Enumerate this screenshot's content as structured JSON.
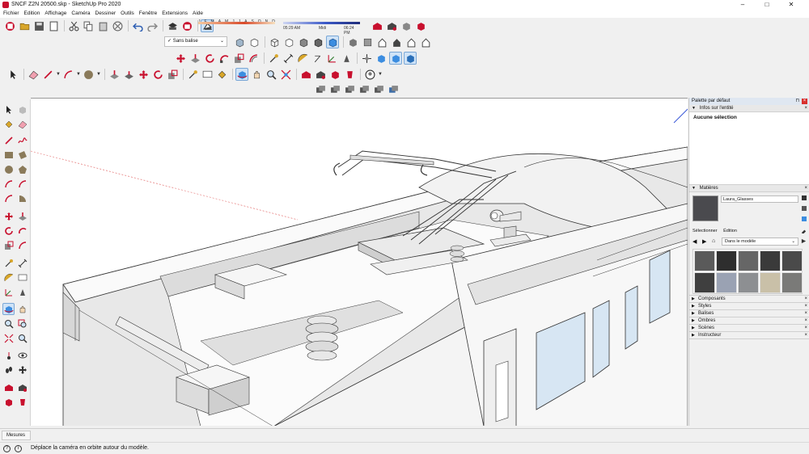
{
  "window": {
    "title": "SNCF Z2N 20500.skp - SketchUp Pro 2020",
    "controls": {
      "minimize": "–",
      "maximize": "□",
      "close": "✕"
    }
  },
  "menu": [
    "Fichier",
    "Edition",
    "Affichage",
    "Caméra",
    "Dessiner",
    "Outils",
    "Fenêtre",
    "Extensions",
    "Aide"
  ],
  "shadows": {
    "months": [
      "J",
      "F",
      "M",
      "A",
      "M",
      "J",
      "J",
      "A",
      "S",
      "O",
      "N",
      "D"
    ],
    "time_start": "05:29 AM",
    "time_mid": "Midi",
    "time_end": "06:24 PM",
    "colors": {
      "month_bar": "#d94a2a",
      "time_bar": "#3a58c8"
    }
  },
  "tag_selector": {
    "value": "Sans balise",
    "check": "✓"
  },
  "panel": {
    "title": "Palette par défaut",
    "entity_info": {
      "header": "Infos sur l'entité",
      "status": "Aucune sélection"
    },
    "materials": {
      "header": "Matières",
      "current": "Laura_Glasses",
      "tab_select": "Sélectionner",
      "tab_edit": "Édition",
      "library": "Dans le modèle",
      "swatches": [
        "#5a5a5a",
        "#2e2e2e",
        "#666666",
        "#3a3a3a",
        "#4a4a4a",
        "#3f3f3f",
        "#9aa2b3",
        "#8d8f92",
        "#c9c0a8",
        "#7a7a78"
      ]
    },
    "trays": [
      "Composants",
      "Styles",
      "Balises",
      "Ombres",
      "Scènes",
      "Instructeur"
    ]
  },
  "measurements": {
    "label": "Mesures"
  },
  "status": {
    "message": "Déplace la caméra en orbite autour du modèle."
  },
  "icons": {
    "toolbar_row1": [
      "new-icon",
      "open-icon",
      "save-icon",
      "save-as-icon",
      "cut-icon",
      "copy-icon",
      "paste-icon",
      "erase-icon",
      "undo-icon",
      "redo-icon",
      "print-icon",
      "model-info-icon"
    ],
    "toolbar_row1b": [
      "shadow-toggle-icon"
    ],
    "toolbar_row1c": [
      "warehouse-icon",
      "share-model-icon",
      "extension-warehouse-icon",
      "layout-icon"
    ]
  }
}
